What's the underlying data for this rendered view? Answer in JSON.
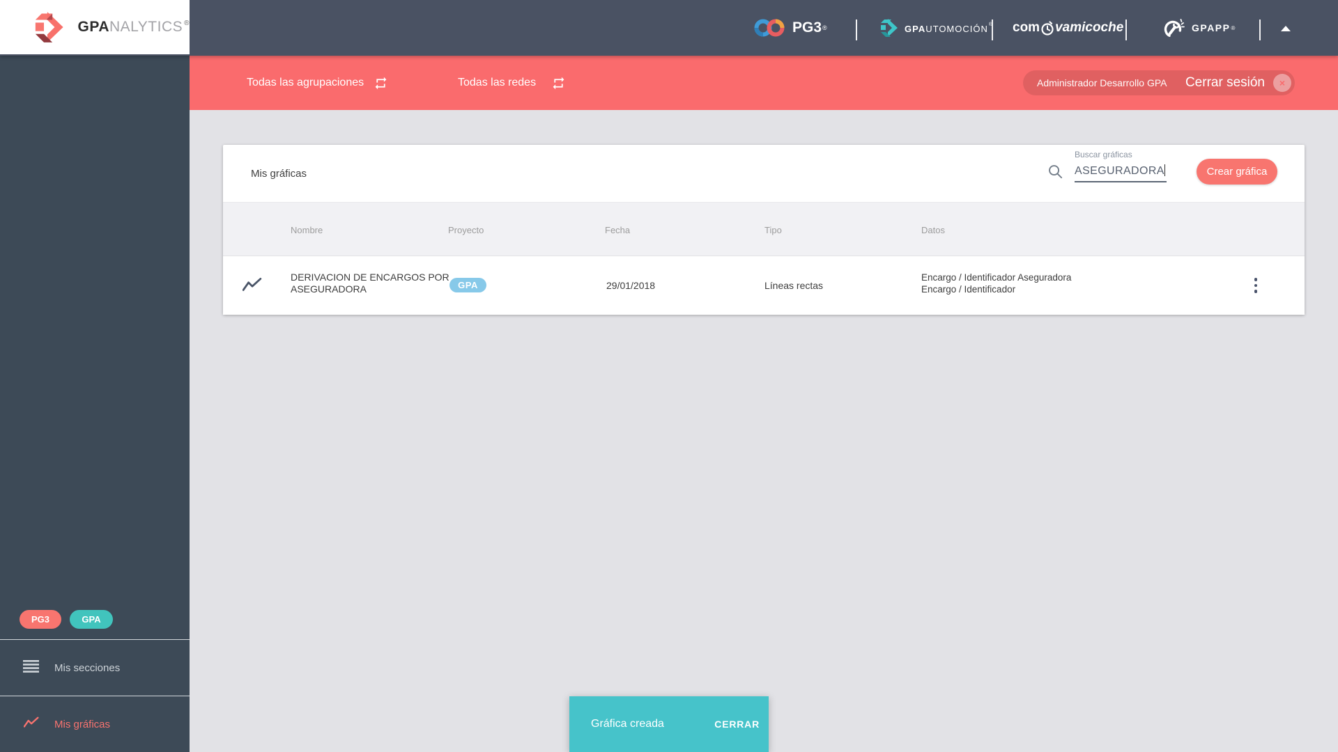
{
  "brand": {
    "bold": "GPA",
    "light": "NALYTICS",
    "reg": "®"
  },
  "header": {
    "pg3": {
      "label": "PG3",
      "reg": "®"
    },
    "automocion": {
      "bold": "GPA",
      "rest": "UTOMOCIÓN",
      "reg": "®"
    },
    "comvamicoche": {
      "left": "com",
      "right": "vamicoche"
    },
    "gpapp": {
      "label": "GPAPP",
      "reg": "®"
    }
  },
  "filter_bar": {
    "agrupaciones": "Todas las agrupaciones",
    "redes": "Todas las redes",
    "usuario": "Administrador Desarrollo GPA",
    "cerrar_sesion": "Cerrar sesión",
    "close_icon": "×"
  },
  "sidebar": {
    "badge_pg3": "PG3",
    "badge_gpa": "GPA",
    "mis_secciones": "Mis secciones",
    "mis_graficas": "Mis gráficas"
  },
  "card": {
    "title": "Mis gráficas",
    "search_label": "Buscar gráficas",
    "search_value": "ASEGURADORA",
    "create_button": "Crear gráfica",
    "table": {
      "headers": [
        "Nombre",
        "Proyecto",
        "Fecha",
        "Tipo",
        "Datos"
      ],
      "rows": [
        {
          "name_line1": "DERIVACION DE ENCARGOS POR",
          "name_line2": "ASEGURADORA",
          "project": "GPA",
          "fecha": "29/01/2018",
          "tipo": "Líneas rectas",
          "datos_line1": "Encargo / Identificador Aseguradora",
          "datos_line2": "Encargo / Identificador"
        }
      ]
    }
  },
  "snackbar": {
    "message": "Gráfica creada",
    "action": "CERRAR"
  },
  "colors": {
    "red_bar": "#fa6b6d",
    "salmon_accent": "#f8756f",
    "teal_badge": "#41c4bd",
    "snackbar_teal": "#46c3ca",
    "project_badge_blue": "#87c9e9",
    "header_dark": "#4a5263",
    "sidebar_dark": "#3d4a57"
  }
}
